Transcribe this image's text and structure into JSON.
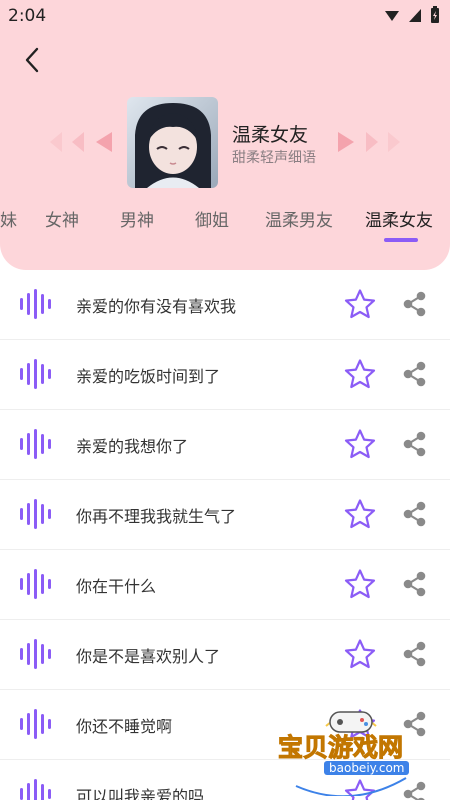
{
  "status": {
    "time": "2:04"
  },
  "voice": {
    "title": "温柔女友",
    "subtitle": "甜柔轻声细语"
  },
  "tabs": [
    {
      "label": "萌妹"
    },
    {
      "label": "女神"
    },
    {
      "label": "男神"
    },
    {
      "label": "御姐"
    },
    {
      "label": "温柔男友"
    },
    {
      "label": "温柔女友",
      "active": true
    }
  ],
  "clips": [
    {
      "label": "亲爱的你有没有喜欢我"
    },
    {
      "label": "亲爱的吃饭时间到了"
    },
    {
      "label": "亲爱的我想你了"
    },
    {
      "label": "你再不理我我就生气了"
    },
    {
      "label": "你在干什么"
    },
    {
      "label": "你是不是喜欢别人了"
    },
    {
      "label": "你还不睡觉啊"
    },
    {
      "label": "可以叫我亲爱的吗"
    }
  ],
  "watermark": {
    "title": "宝贝游戏网",
    "url": "baobeiy.com"
  },
  "colors": {
    "header_bg": "#fdd6da",
    "accent": "#8b5cf6",
    "arrow": "#f4a3ad"
  },
  "icons": {
    "back": "chevron-left-icon",
    "wave": "sound-wave-icon",
    "favorite": "star-outline-icon",
    "share": "share-icon"
  }
}
